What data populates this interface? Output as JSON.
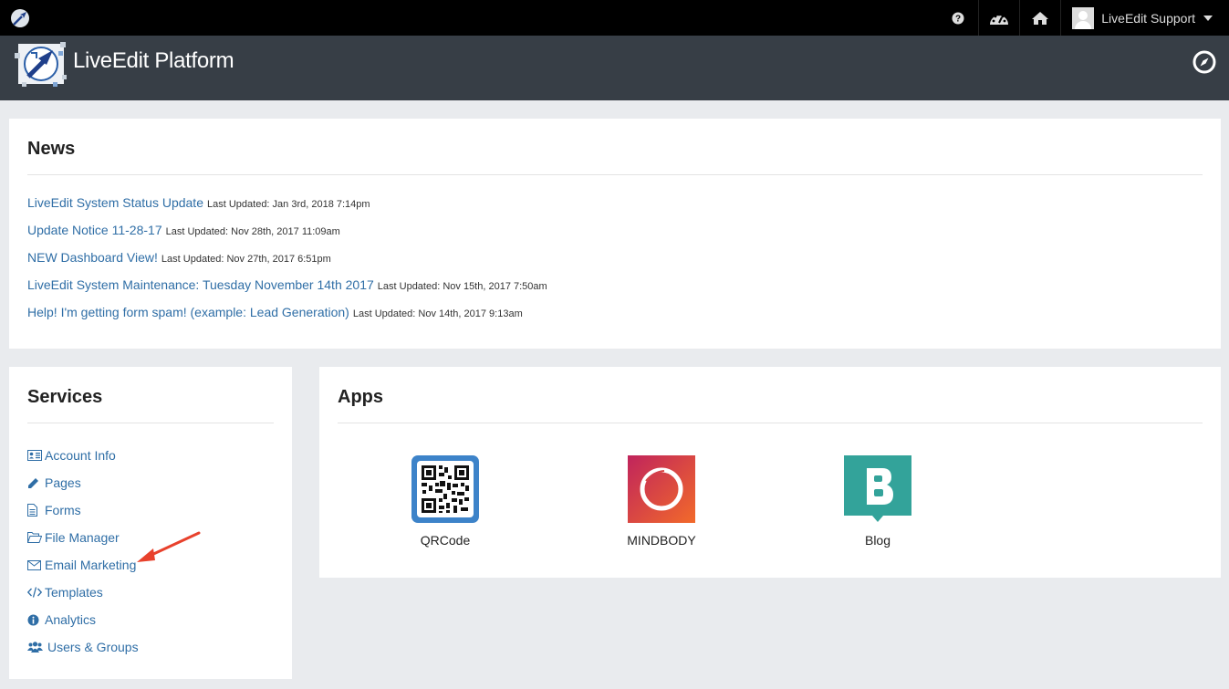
{
  "topbar": {
    "user_name": "LiveEdit Support",
    "icons": [
      "help-icon",
      "dashboard-icon",
      "home-icon"
    ]
  },
  "header": {
    "title": "LiveEdit Platform"
  },
  "news": {
    "title": "News",
    "items": [
      {
        "title": "LiveEdit System Status Update",
        "date": "Last Updated: Jan 3rd, 2018 7:14pm"
      },
      {
        "title": "Update Notice 11-28-17",
        "date": "Last Updated: Nov 28th, 2017 11:09am"
      },
      {
        "title": "NEW Dashboard View!",
        "date": "Last Updated: Nov 27th, 2017 6:51pm"
      },
      {
        "title": "LiveEdit System Maintenance: Tuesday November 14th 2017",
        "date": "Last Updated: Nov 15th, 2017 7:50am"
      },
      {
        "title": "Help! I'm getting form spam! (example: Lead Generation)",
        "date": "Last Updated: Nov 14th, 2017 9:13am"
      }
    ]
  },
  "services": {
    "title": "Services",
    "items": [
      {
        "label": "Account Info",
        "icon": "id-card-icon"
      },
      {
        "label": "Pages",
        "icon": "pencil-icon"
      },
      {
        "label": "Forms",
        "icon": "document-icon"
      },
      {
        "label": "File Manager",
        "icon": "folder-icon"
      },
      {
        "label": "Email Marketing",
        "icon": "envelope-icon"
      },
      {
        "label": "Templates",
        "icon": "code-icon"
      },
      {
        "label": "Analytics",
        "icon": "info-icon"
      },
      {
        "label": "Users & Groups",
        "icon": "users-icon"
      }
    ]
  },
  "apps": {
    "title": "Apps",
    "items": [
      {
        "label": "QRCode",
        "icon": "qrcode-icon",
        "color": "#3d83c9"
      },
      {
        "label": "MINDBODY",
        "icon": "mindbody-icon",
        "color": "#e2403a"
      },
      {
        "label": "Blog",
        "icon": "blog-icon",
        "color": "#33a39a"
      }
    ]
  },
  "colors": {
    "link": "#2f6ea6",
    "header_bg": "#373e46",
    "topbar_bg": "#000000",
    "annotation_arrow": "#e8412c"
  }
}
